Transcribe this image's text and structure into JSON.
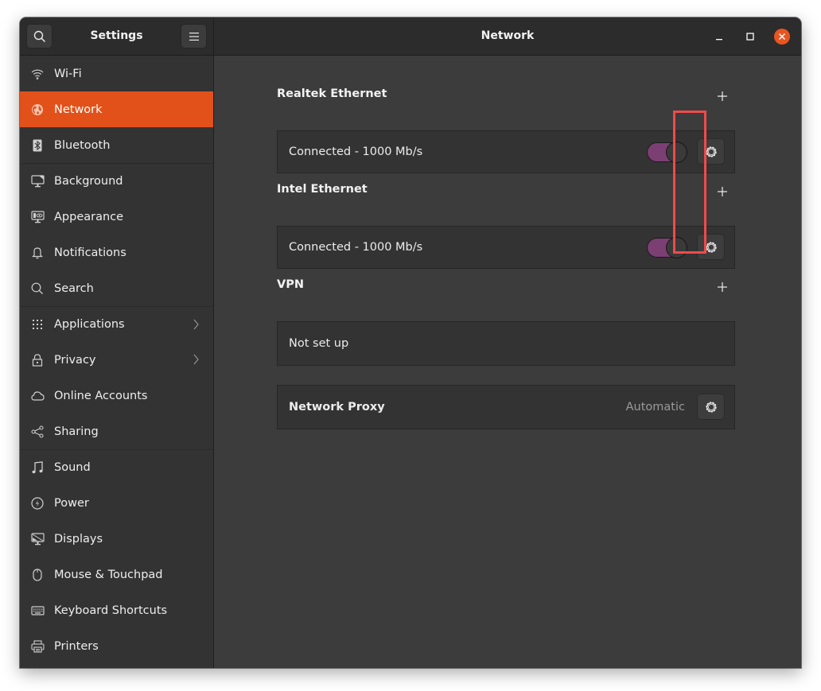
{
  "window": {
    "sidebar_title": "Settings",
    "page_title": "Network",
    "controls": {
      "minimize": "minimize-icon",
      "maximize": "maximize-icon",
      "close": "close-icon"
    },
    "accent_color": "#e95420"
  },
  "sidebar": {
    "search_icon": "search-icon",
    "menu_icon": "hamburger-menu-icon",
    "items": [
      {
        "label": "Wi-Fi",
        "icon": "wifi-icon",
        "active": false
      },
      {
        "label": "Network",
        "icon": "network-globe-icon",
        "active": true
      },
      {
        "label": "Bluetooth",
        "icon": "bluetooth-icon",
        "active": false
      },
      {
        "label": "Background",
        "icon": "background-icon",
        "active": false
      },
      {
        "label": "Appearance",
        "icon": "appearance-icon",
        "active": false
      },
      {
        "label": "Notifications",
        "icon": "bell-icon",
        "active": false
      },
      {
        "label": "Search",
        "icon": "search-icon",
        "active": false
      },
      {
        "label": "Applications",
        "icon": "grid-icon",
        "active": false,
        "has_submenu": true
      },
      {
        "label": "Privacy",
        "icon": "lock-icon",
        "active": false,
        "has_submenu": true
      },
      {
        "label": "Online Accounts",
        "icon": "cloud-icon",
        "active": false
      },
      {
        "label": "Sharing",
        "icon": "share-icon",
        "active": false
      },
      {
        "label": "Sound",
        "icon": "music-note-icon",
        "active": false
      },
      {
        "label": "Power",
        "icon": "power-icon",
        "active": false
      },
      {
        "label": "Displays",
        "icon": "display-icon",
        "active": false
      },
      {
        "label": "Mouse & Touchpad",
        "icon": "mouse-icon",
        "active": false
      },
      {
        "label": "Keyboard Shortcuts",
        "icon": "keyboard-icon",
        "active": false
      },
      {
        "label": "Printers",
        "icon": "printer-icon",
        "active": false
      }
    ],
    "active_color": "#e2511a"
  },
  "main": {
    "sections": [
      {
        "title": "Realtek Ethernet",
        "status": "Connected - 1000 Mb/s",
        "enabled": true
      },
      {
        "title": "Intel Ethernet",
        "status": "Connected - 1000 Mb/s",
        "enabled": true
      },
      {
        "title": "VPN",
        "status": "Not set up"
      }
    ],
    "proxy": {
      "label": "Network Proxy",
      "status": "Automatic"
    },
    "toggle_on_color": "#7b3f73",
    "highlight_color": "#f04a4a"
  }
}
